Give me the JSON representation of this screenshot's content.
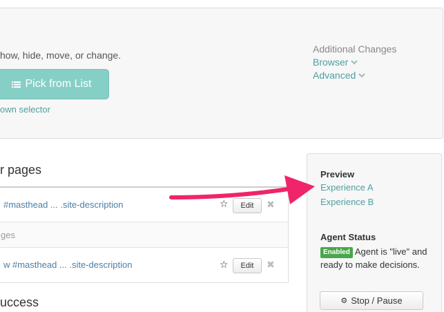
{
  "top": {
    "instruction": "how, hide, move, or change.",
    "pick_button": "Pick from List",
    "own_selector": "own selector",
    "additional_title": "Additional Changes",
    "browser_link": "Browser",
    "advanced_link": "Advanced",
    "list_icon": "list-icon",
    "chevron_icon": "chevron-down-icon"
  },
  "pages": {
    "title": "r pages",
    "rows": [
      {
        "selector": "#masthead ... .site-description"
      },
      {
        "subtle": "ges"
      },
      {
        "selector": "w #masthead ... .site-description"
      }
    ],
    "star": "☆",
    "edit_label": "Edit",
    "remove": "✖"
  },
  "success_title": "uccess",
  "sidebar": {
    "preview_heading": "Preview",
    "experience_a": "Experience A",
    "experience_b": "Experience B",
    "status_heading": "Agent Status",
    "badge": "Enabled",
    "status_text": "Agent is \"live\" and ready to make decisions.",
    "stop_button": "Stop / Pause"
  },
  "colors": {
    "accent": "#86cfc7",
    "link": "#4f9fa0",
    "selector_link": "#4a7fa8",
    "badge": "#4aa64a",
    "arrow": "#f0246a"
  }
}
